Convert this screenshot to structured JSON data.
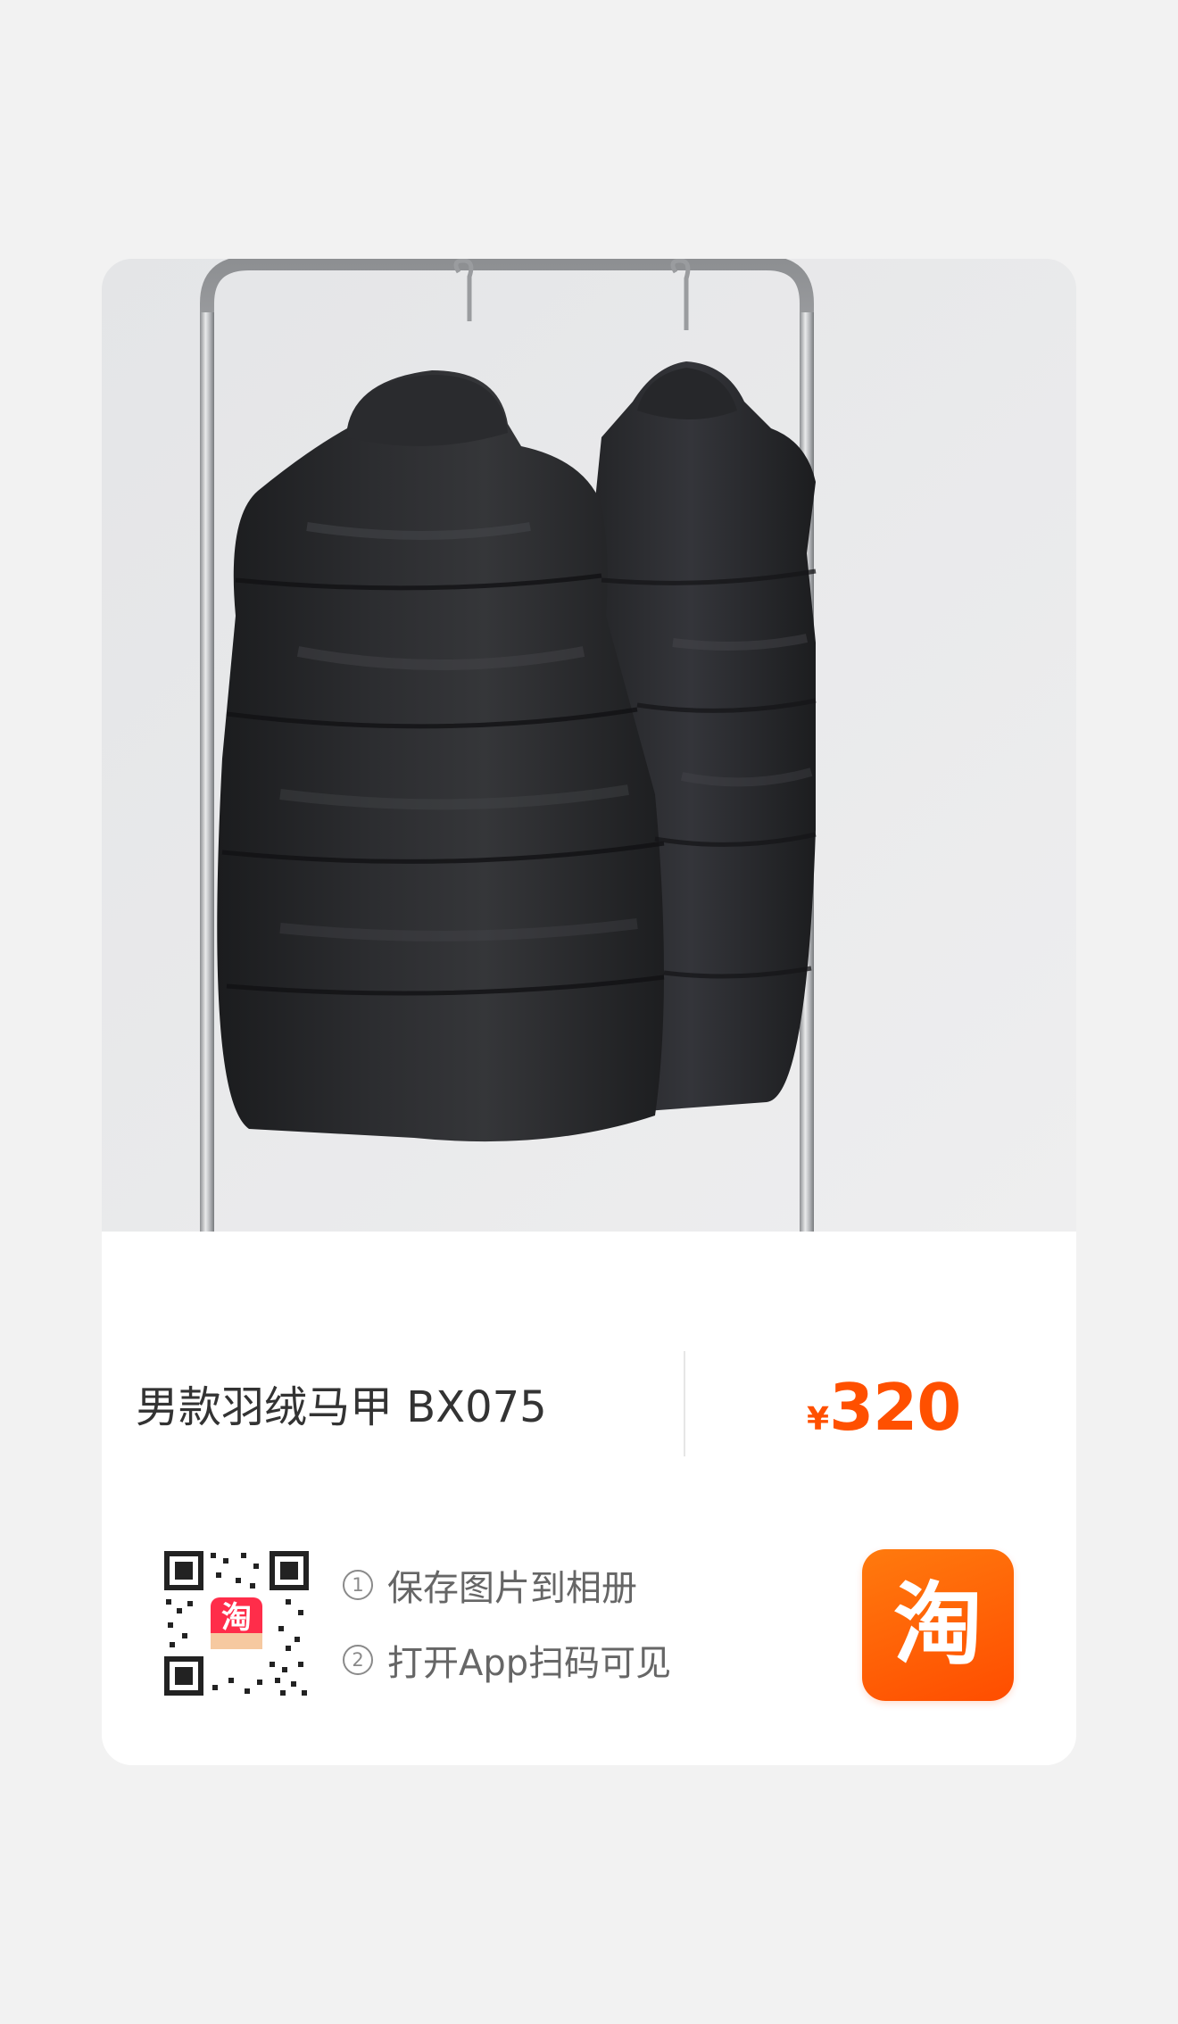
{
  "product": {
    "title": "男款羽绒马甲 BX075",
    "currency_symbol": "¥",
    "price": "320"
  },
  "photo": {
    "subject": "two black down vests hanging on a metal clothing rack"
  },
  "share": {
    "qr_app_badge_label": "淘",
    "steps": [
      {
        "num": "1",
        "text": "保存图片到相册"
      },
      {
        "num": "2",
        "text": "打开App扫码可见"
      }
    ],
    "app_logo_label": "淘"
  },
  "colors": {
    "page_background": "#f2f2f2",
    "card_background": "#ffffff",
    "price": "#ff5000",
    "app_logo": "#ff5a00",
    "title_text": "#333333",
    "step_text": "#666666"
  },
  "icons": [
    "clothing-rack",
    "qr-code-icon",
    "taobao-logo-icon"
  ]
}
